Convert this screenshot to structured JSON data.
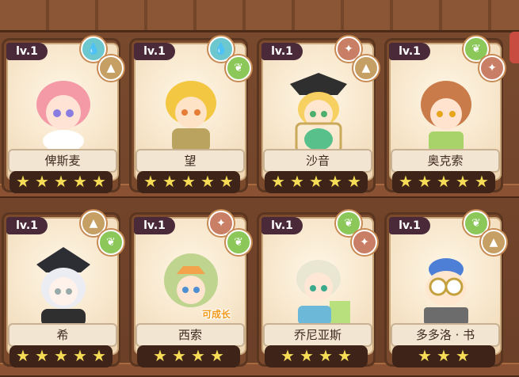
{
  "colors": {
    "water": "#6cc7cf",
    "earth": "#c59f63",
    "plant": "#8bc759",
    "spark": "#c97f66",
    "star": "#f7dd57"
  },
  "cards": [
    {
      "level": "lv.1",
      "name": "俾斯麦",
      "stars": 5,
      "icons": [
        "water-icon",
        "earth-icon"
      ]
    },
    {
      "level": "lv.1",
      "name": "望",
      "stars": 5,
      "icons": [
        "water-icon",
        "plant-icon"
      ]
    },
    {
      "level": "lv.1",
      "name": "沙音",
      "stars": 5,
      "icons": [
        "spark-icon",
        "earth-icon"
      ]
    },
    {
      "level": "lv.1",
      "name": "奥克索",
      "stars": 5,
      "icons": [
        "plant-icon",
        "spark-icon"
      ]
    },
    {
      "level": "lv.1",
      "name": "希",
      "stars": 5,
      "icons": [
        "earth-icon",
        "plant-icon"
      ]
    },
    {
      "level": "lv.1",
      "name": "西索",
      "stars": 4,
      "growable": "可成长",
      "icons": [
        "spark-icon",
        "plant-icon"
      ]
    },
    {
      "level": "lv.1",
      "name": "乔尼亚斯",
      "stars": 4,
      "icons": [
        "plant-icon",
        "spark-icon"
      ]
    },
    {
      "level": "lv.1",
      "name": "多多洛 · 书",
      "stars": 3,
      "icons": [
        "plant-icon",
        "earth-icon"
      ]
    }
  ]
}
